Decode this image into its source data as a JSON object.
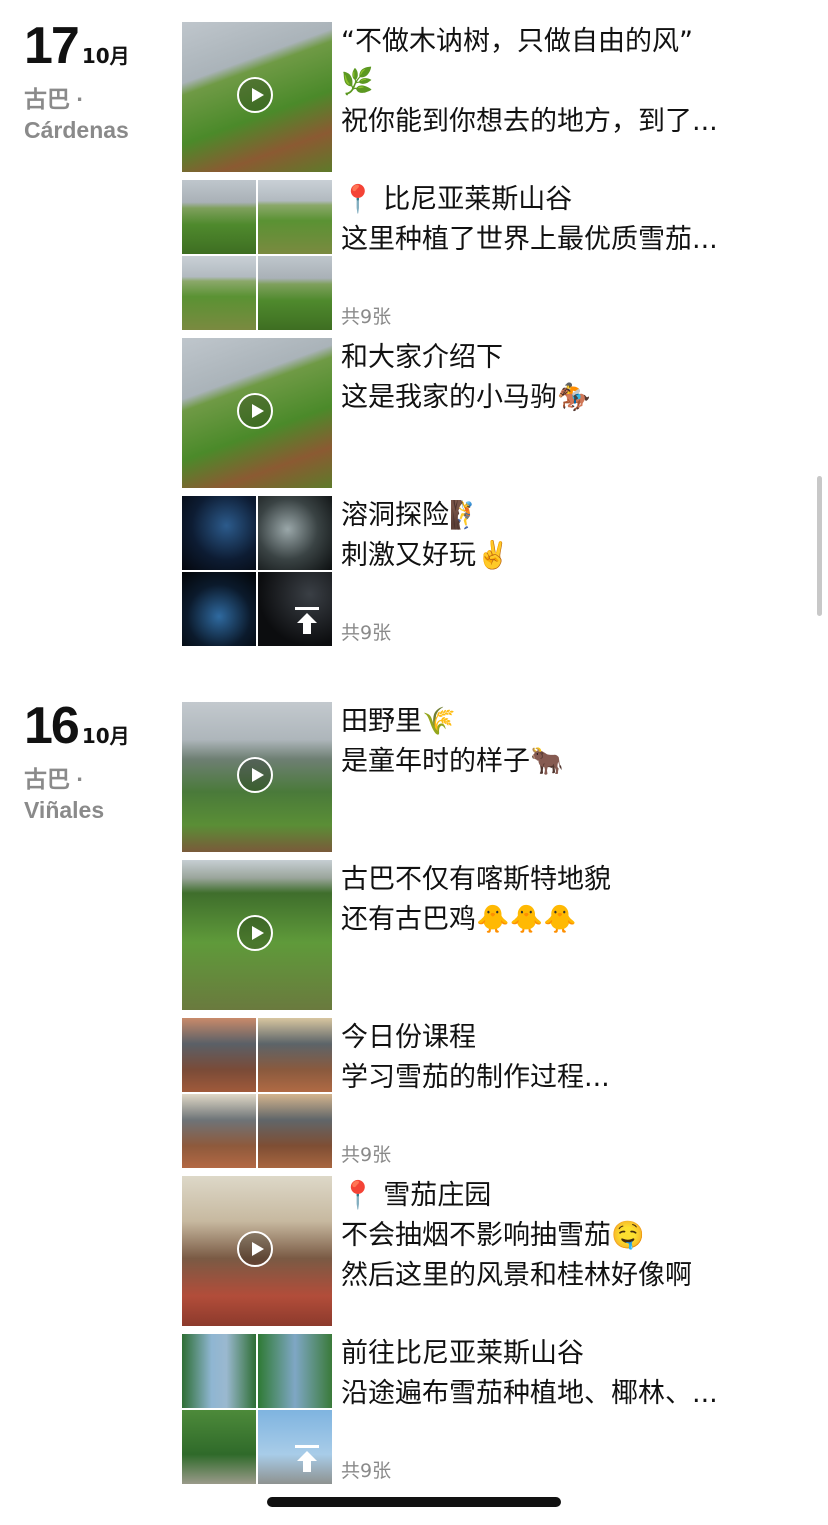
{
  "days": [
    {
      "day": "17",
      "month": "10月",
      "location_line1": "古巴 ·",
      "location_line2": "Cárdenas",
      "posts": [
        {
          "media": "video",
          "lines": [
            "“不做木讷树，只做自由的风”",
            "🌿",
            "祝你能到你想去的地方，到了..."
          ]
        },
        {
          "media": "grid",
          "lines": [
            "📍 比尼亚莱斯山谷",
            "这里种植了世界上最优质雪茄..."
          ],
          "count": "共9张"
        },
        {
          "media": "video",
          "lines": [
            "和大家介绍下",
            "这是我家的小马驹🏇"
          ]
        },
        {
          "media": "grid",
          "lines": [
            "溶洞探险🧗",
            "刺激又好玩✌️"
          ],
          "count": "共9张"
        }
      ]
    },
    {
      "day": "16",
      "month": "10月",
      "location_line1": "古巴 ·",
      "location_line2": "Viñales",
      "posts": [
        {
          "media": "video",
          "lines": [
            "田野里🌾",
            "是童年时的样子🐂"
          ]
        },
        {
          "media": "video",
          "lines": [
            "古巴不仅有喀斯特地貌",
            "还有古巴鸡🐥🐥🐥"
          ]
        },
        {
          "media": "grid",
          "lines": [
            "今日份课程",
            "学习雪茄的制作过程..."
          ],
          "count": "共9张"
        },
        {
          "media": "video",
          "lines": [
            "📍 雪茄庄园",
            "不会抽烟不影响抽雪茄🤤",
            "然后这里的风景和桂林好像啊"
          ]
        },
        {
          "media": "grid",
          "lines": [
            "前往比尼亚莱斯山谷",
            "沿途遍布雪茄种植地、椰林、..."
          ],
          "count": "共9张"
        }
      ]
    }
  ]
}
